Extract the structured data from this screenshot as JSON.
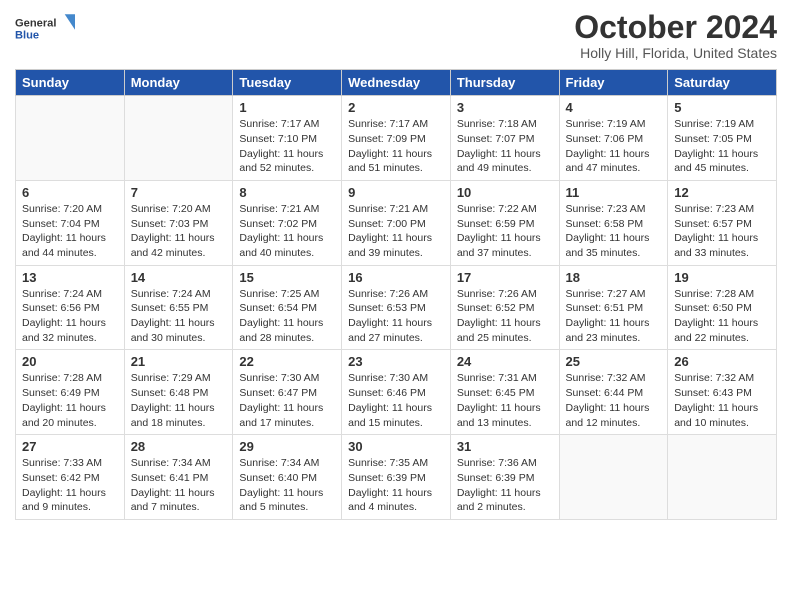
{
  "logo": {
    "line1": "General",
    "line2": "Blue"
  },
  "title": "October 2024",
  "location": "Holly Hill, Florida, United States",
  "days_of_week": [
    "Sunday",
    "Monday",
    "Tuesday",
    "Wednesday",
    "Thursday",
    "Friday",
    "Saturday"
  ],
  "weeks": [
    [
      {
        "day": "",
        "info": ""
      },
      {
        "day": "",
        "info": ""
      },
      {
        "day": "1",
        "info": "Sunrise: 7:17 AM\nSunset: 7:10 PM\nDaylight: 11 hours and 52 minutes."
      },
      {
        "day": "2",
        "info": "Sunrise: 7:17 AM\nSunset: 7:09 PM\nDaylight: 11 hours and 51 minutes."
      },
      {
        "day": "3",
        "info": "Sunrise: 7:18 AM\nSunset: 7:07 PM\nDaylight: 11 hours and 49 minutes."
      },
      {
        "day": "4",
        "info": "Sunrise: 7:19 AM\nSunset: 7:06 PM\nDaylight: 11 hours and 47 minutes."
      },
      {
        "day": "5",
        "info": "Sunrise: 7:19 AM\nSunset: 7:05 PM\nDaylight: 11 hours and 45 minutes."
      }
    ],
    [
      {
        "day": "6",
        "info": "Sunrise: 7:20 AM\nSunset: 7:04 PM\nDaylight: 11 hours and 44 minutes."
      },
      {
        "day": "7",
        "info": "Sunrise: 7:20 AM\nSunset: 7:03 PM\nDaylight: 11 hours and 42 minutes."
      },
      {
        "day": "8",
        "info": "Sunrise: 7:21 AM\nSunset: 7:02 PM\nDaylight: 11 hours and 40 minutes."
      },
      {
        "day": "9",
        "info": "Sunrise: 7:21 AM\nSunset: 7:00 PM\nDaylight: 11 hours and 39 minutes."
      },
      {
        "day": "10",
        "info": "Sunrise: 7:22 AM\nSunset: 6:59 PM\nDaylight: 11 hours and 37 minutes."
      },
      {
        "day": "11",
        "info": "Sunrise: 7:23 AM\nSunset: 6:58 PM\nDaylight: 11 hours and 35 minutes."
      },
      {
        "day": "12",
        "info": "Sunrise: 7:23 AM\nSunset: 6:57 PM\nDaylight: 11 hours and 33 minutes."
      }
    ],
    [
      {
        "day": "13",
        "info": "Sunrise: 7:24 AM\nSunset: 6:56 PM\nDaylight: 11 hours and 32 minutes."
      },
      {
        "day": "14",
        "info": "Sunrise: 7:24 AM\nSunset: 6:55 PM\nDaylight: 11 hours and 30 minutes."
      },
      {
        "day": "15",
        "info": "Sunrise: 7:25 AM\nSunset: 6:54 PM\nDaylight: 11 hours and 28 minutes."
      },
      {
        "day": "16",
        "info": "Sunrise: 7:26 AM\nSunset: 6:53 PM\nDaylight: 11 hours and 27 minutes."
      },
      {
        "day": "17",
        "info": "Sunrise: 7:26 AM\nSunset: 6:52 PM\nDaylight: 11 hours and 25 minutes."
      },
      {
        "day": "18",
        "info": "Sunrise: 7:27 AM\nSunset: 6:51 PM\nDaylight: 11 hours and 23 minutes."
      },
      {
        "day": "19",
        "info": "Sunrise: 7:28 AM\nSunset: 6:50 PM\nDaylight: 11 hours and 22 minutes."
      }
    ],
    [
      {
        "day": "20",
        "info": "Sunrise: 7:28 AM\nSunset: 6:49 PM\nDaylight: 11 hours and 20 minutes."
      },
      {
        "day": "21",
        "info": "Sunrise: 7:29 AM\nSunset: 6:48 PM\nDaylight: 11 hours and 18 minutes."
      },
      {
        "day": "22",
        "info": "Sunrise: 7:30 AM\nSunset: 6:47 PM\nDaylight: 11 hours and 17 minutes."
      },
      {
        "day": "23",
        "info": "Sunrise: 7:30 AM\nSunset: 6:46 PM\nDaylight: 11 hours and 15 minutes."
      },
      {
        "day": "24",
        "info": "Sunrise: 7:31 AM\nSunset: 6:45 PM\nDaylight: 11 hours and 13 minutes."
      },
      {
        "day": "25",
        "info": "Sunrise: 7:32 AM\nSunset: 6:44 PM\nDaylight: 11 hours and 12 minutes."
      },
      {
        "day": "26",
        "info": "Sunrise: 7:32 AM\nSunset: 6:43 PM\nDaylight: 11 hours and 10 minutes."
      }
    ],
    [
      {
        "day": "27",
        "info": "Sunrise: 7:33 AM\nSunset: 6:42 PM\nDaylight: 11 hours and 9 minutes."
      },
      {
        "day": "28",
        "info": "Sunrise: 7:34 AM\nSunset: 6:41 PM\nDaylight: 11 hours and 7 minutes."
      },
      {
        "day": "29",
        "info": "Sunrise: 7:34 AM\nSunset: 6:40 PM\nDaylight: 11 hours and 5 minutes."
      },
      {
        "day": "30",
        "info": "Sunrise: 7:35 AM\nSunset: 6:39 PM\nDaylight: 11 hours and 4 minutes."
      },
      {
        "day": "31",
        "info": "Sunrise: 7:36 AM\nSunset: 6:39 PM\nDaylight: 11 hours and 2 minutes."
      },
      {
        "day": "",
        "info": ""
      },
      {
        "day": "",
        "info": ""
      }
    ]
  ]
}
